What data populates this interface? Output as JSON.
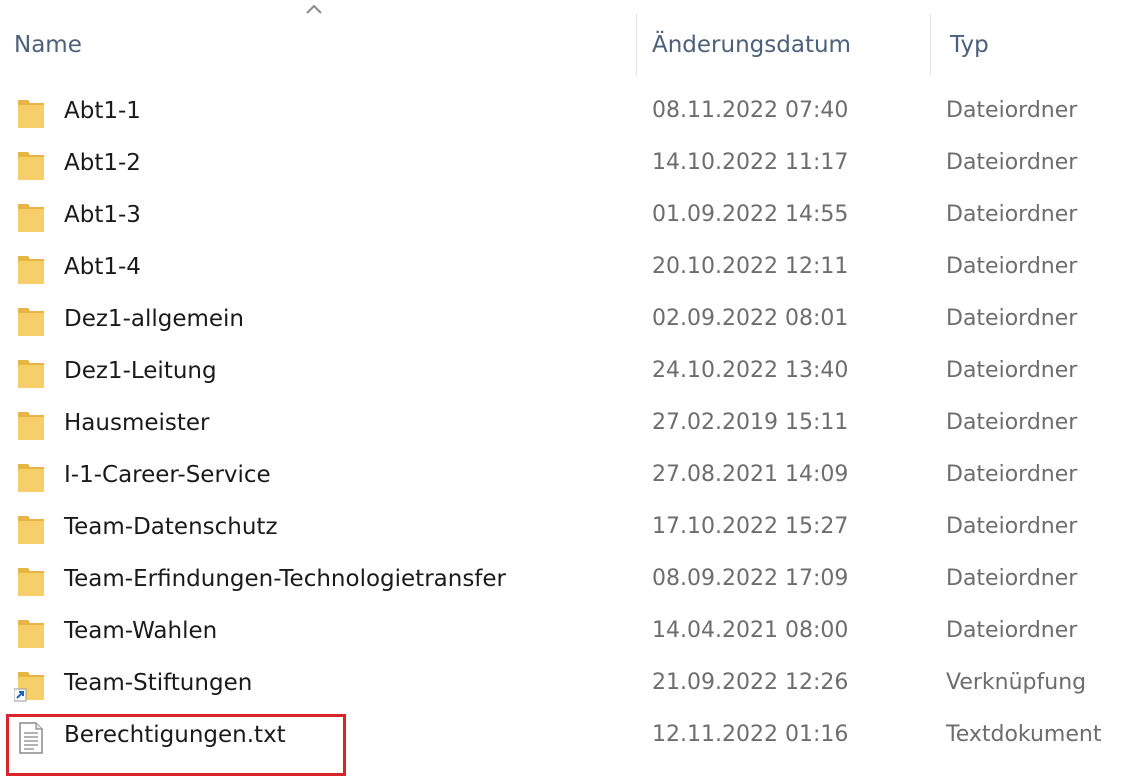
{
  "columns": {
    "name": "Name",
    "date": "Änderungsdatum",
    "type": "Typ"
  },
  "sort_indicator": "chevron-up-icon",
  "rows": [
    {
      "name": "Abt1-1",
      "date": "08.11.2022 07:40",
      "type": "Dateiordner",
      "icon": "folder-icon"
    },
    {
      "name": "Abt1-2",
      "date": "14.10.2022 11:17",
      "type": "Dateiordner",
      "icon": "folder-icon"
    },
    {
      "name": "Abt1-3",
      "date": "01.09.2022 14:55",
      "type": "Dateiordner",
      "icon": "folder-icon"
    },
    {
      "name": "Abt1-4",
      "date": "20.10.2022 12:11",
      "type": "Dateiordner",
      "icon": "folder-icon"
    },
    {
      "name": "Dez1-allgemein",
      "date": "02.09.2022 08:01",
      "type": "Dateiordner",
      "icon": "folder-icon"
    },
    {
      "name": "Dez1-Leitung",
      "date": "24.10.2022 13:40",
      "type": "Dateiordner",
      "icon": "folder-icon"
    },
    {
      "name": "Hausmeister",
      "date": "27.02.2019 15:11",
      "type": "Dateiordner",
      "icon": "folder-icon"
    },
    {
      "name": "I-1-Career-Service",
      "date": "27.08.2021 14:09",
      "type": "Dateiordner",
      "icon": "folder-icon"
    },
    {
      "name": "Team-Datenschutz",
      "date": "17.10.2022 15:27",
      "type": "Dateiordner",
      "icon": "folder-icon"
    },
    {
      "name": "Team-Erfindungen-Technologietransfer",
      "date": "08.09.2022 17:09",
      "type": "Dateiordner",
      "icon": "folder-icon"
    },
    {
      "name": "Team-Wahlen",
      "date": "14.04.2021 08:00",
      "type": "Dateiordner",
      "icon": "folder-icon"
    },
    {
      "name": "Team-Stiftungen",
      "date": "21.09.2022 12:26",
      "type": "Verknüpfung",
      "icon": "folder-shortcut-icon"
    },
    {
      "name": "Berechtigungen.txt",
      "date": "12.11.2022 01:16",
      "type": "Textdokument",
      "icon": "text-document-icon"
    }
  ],
  "colors": {
    "highlight_border": "#d9242b",
    "folder": "#f4c55e",
    "header_text": "#4c607a"
  }
}
